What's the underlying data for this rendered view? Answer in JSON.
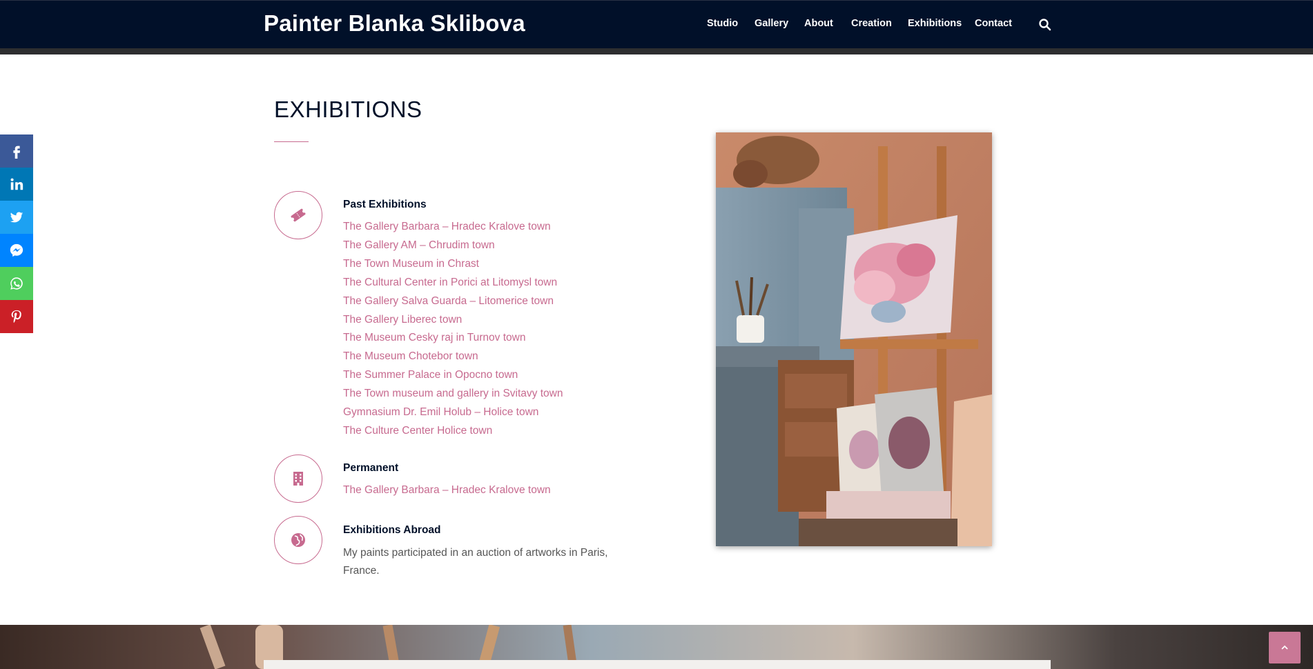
{
  "header": {
    "brand": "Painter Blanka Sklibova",
    "nav": [
      "Studio",
      "Gallery",
      "About",
      "Creation",
      "Exhibitions",
      "Contact"
    ]
  },
  "social": [
    "facebook-icon",
    "linkedin-icon",
    "twitter-icon",
    "messenger-icon",
    "whatsapp-icon",
    "pinterest-icon"
  ],
  "colors": {
    "header_bg": "#011029",
    "accent": "#c76a8f",
    "facebook": "#3b5998",
    "linkedin": "#0077b5",
    "twitter": "#1da1f2",
    "messenger": "#0084ff",
    "whatsapp": "#4fce5d",
    "pinterest": "#cb2027"
  },
  "section": {
    "title": "EXHIBITIONS",
    "past": {
      "title": "Past Exhibitions",
      "items": [
        "The Gallery Barbara – Hradec Kralove town",
        "The Gallery AM – Chrudim town",
        "The Town Museum in Chrast",
        "The Cultural Center in Porici at Litomysl town",
        "The Gallery Salva Guarda – Litomerice town",
        "The Gallery Liberec town",
        "The Museum Cesky raj in Turnov town",
        "The Museum Chotebor town",
        "The Summer Palace in Opocno town",
        "The Town museum and gallery in Svitavy town",
        "Gymnasium Dr. Emil Holub – Holice town",
        "The Culture Center Holice town"
      ]
    },
    "permanent": {
      "title": "Permanent",
      "items": [
        "The Gallery Barbara – Hradec Kralove town"
      ]
    },
    "abroad": {
      "title": "Exhibitions Abroad",
      "text": "My paints participated in an auction of artworks in Paris, France."
    }
  }
}
